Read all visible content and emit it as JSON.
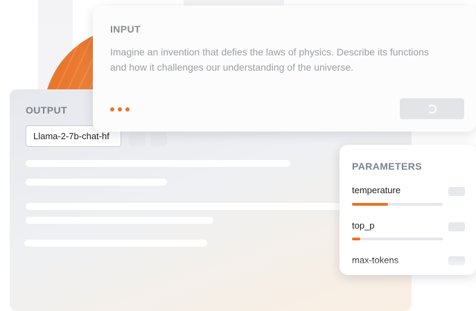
{
  "input": {
    "label": "INPUT",
    "prompt": "Imagine an invention that defies the laws of physics. Describe its functions and how it challenges our understanding of the universe."
  },
  "output": {
    "label": "OUTPUT",
    "model": "Llama-2-7b-chat-hf"
  },
  "parameters": {
    "title": "PARAMETERS",
    "items": [
      {
        "label": "temperature",
        "fill_pct": 40
      },
      {
        "label": "top_p",
        "fill_pct": 9
      },
      {
        "label": "max-tokens",
        "fill_pct": 0
      }
    ]
  },
  "colors": {
    "accent": "#e8732c",
    "panel_bg": "#eceef2",
    "muted_text": "#9b9ea3"
  },
  "icons": {
    "loading": "spinner-icon",
    "typing": "ellipsis-dots-icon"
  }
}
